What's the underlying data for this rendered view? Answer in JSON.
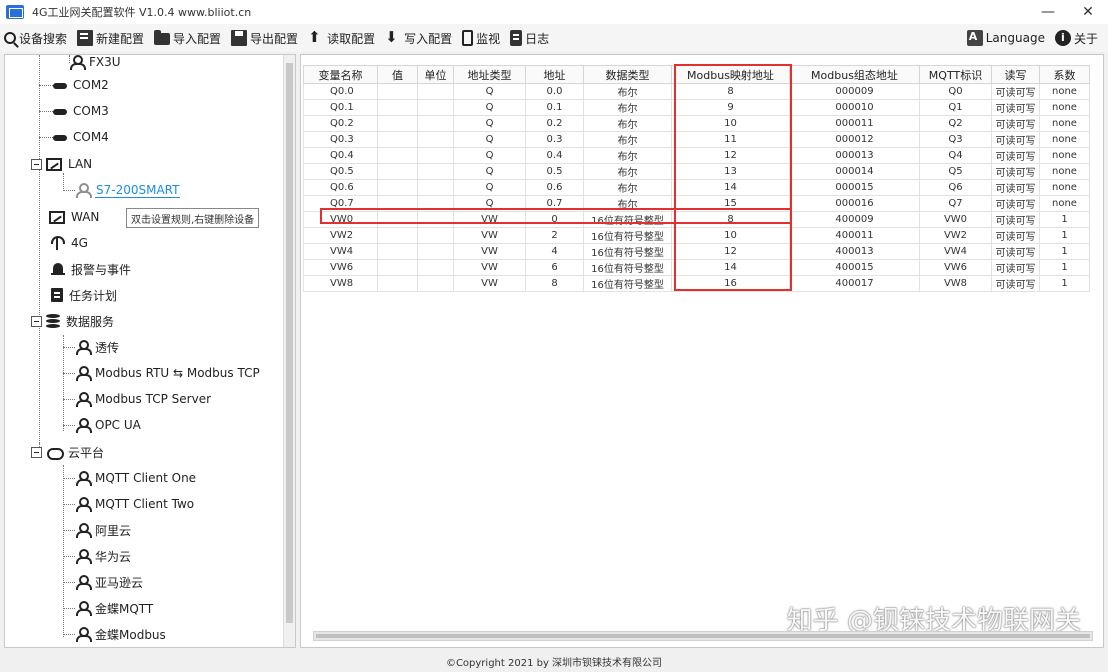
{
  "window": {
    "title": "4G工业网关配置软件 V1.0.4 www.bliiot.cn",
    "minimize": "—",
    "close": "✕"
  },
  "toolbar": {
    "search": "设备搜索",
    "new_config": "新建配置",
    "import_config": "导入配置",
    "export_config": "导出配置",
    "read_config": "读取配置",
    "write_config": "写入配置",
    "monitor": "监视",
    "log": "日志",
    "language": "Language",
    "about": "关于"
  },
  "tree": {
    "fx3u": "FX3U",
    "com2": "COM2",
    "com3": "COM3",
    "com4": "COM4",
    "lan": "LAN",
    "s7": "S7-200SMART",
    "wan": "WAN",
    "g4": "4G",
    "alarm": "报警与事件",
    "task": "任务计划",
    "data_service": "数据服务",
    "passthrough": "透传",
    "modbus_rtu_tcp": "Modbus RTU ⇆ Modbus TCP",
    "modbus_tcp_server": "Modbus TCP Server",
    "opc_ua": "OPC UA",
    "cloud": "云平台",
    "mqtt_one": "MQTT Client One",
    "mqtt_two": "MQTT Client Two",
    "aliyun": "阿里云",
    "huawei": "华为云",
    "amazon": "亚马逊云",
    "kingdee_mqtt": "金蝶MQTT",
    "kingdee_modbus": "金蝶Modbus"
  },
  "tooltip": "双击设置规则,右键删除设备",
  "table": {
    "headers": [
      "变量名称",
      "值",
      "单位",
      "地址类型",
      "地址",
      "数据类型",
      "Modbus映射地址",
      "Modbus组态地址",
      "MQTT标识",
      "读写",
      "系数"
    ],
    "rows": [
      [
        "Q0.0",
        "",
        "",
        "Q",
        "0.0",
        "布尔",
        "8",
        "000009",
        "Q0",
        "可读可写",
        "none"
      ],
      [
        "Q0.1",
        "",
        "",
        "Q",
        "0.1",
        "布尔",
        "9",
        "000010",
        "Q1",
        "可读可写",
        "none"
      ],
      [
        "Q0.2",
        "",
        "",
        "Q",
        "0.2",
        "布尔",
        "10",
        "000011",
        "Q2",
        "可读可写",
        "none"
      ],
      [
        "Q0.3",
        "",
        "",
        "Q",
        "0.3",
        "布尔",
        "11",
        "000012",
        "Q3",
        "可读可写",
        "none"
      ],
      [
        "Q0.4",
        "",
        "",
        "Q",
        "0.4",
        "布尔",
        "12",
        "000013",
        "Q4",
        "可读可写",
        "none"
      ],
      [
        "Q0.5",
        "",
        "",
        "Q",
        "0.5",
        "布尔",
        "13",
        "000014",
        "Q5",
        "可读可写",
        "none"
      ],
      [
        "Q0.6",
        "",
        "",
        "Q",
        "0.6",
        "布尔",
        "14",
        "000015",
        "Q6",
        "可读可写",
        "none"
      ],
      [
        "Q0.7",
        "",
        "",
        "Q",
        "0.7",
        "布尔",
        "15",
        "000016",
        "Q7",
        "可读可写",
        "none"
      ],
      [
        "VW0",
        "",
        "",
        "VW",
        "0",
        "16位有符号整型",
        "8",
        "400009",
        "VW0",
        "可读可写",
        "1"
      ],
      [
        "VW2",
        "",
        "",
        "VW",
        "2",
        "16位有符号整型",
        "10",
        "400011",
        "VW2",
        "可读可写",
        "1"
      ],
      [
        "VW4",
        "",
        "",
        "VW",
        "4",
        "16位有符号整型",
        "12",
        "400013",
        "VW4",
        "可读可写",
        "1"
      ],
      [
        "VW6",
        "",
        "",
        "VW",
        "6",
        "16位有符号整型",
        "14",
        "400015",
        "VW6",
        "可读可写",
        "1"
      ],
      [
        "VW8",
        "",
        "",
        "VW",
        "8",
        "16位有符号整型",
        "16",
        "400017",
        "VW8",
        "可读可写",
        "1"
      ]
    ]
  },
  "watermark": "知乎 @钡铼技术物联网关",
  "footer": "©Copyright 2021 by 深圳市钡铼技术有限公司",
  "colors": {
    "highlight": "#e03030",
    "selected": "#1a8fe0"
  }
}
